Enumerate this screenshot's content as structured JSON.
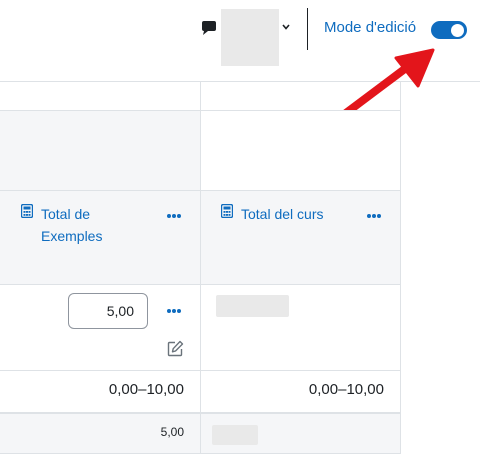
{
  "navbar": {
    "messages_icon": "chat-bubble-icon",
    "user_menu_icon": "chevron-down-icon",
    "edit_mode_label": "Mode d'edició",
    "edit_mode_on": true
  },
  "colors": {
    "accent": "#0f6cbf",
    "annotation": "#e3151b",
    "header_bg": "#f5f6f8",
    "border": "#dee2e6"
  },
  "columns": [
    {
      "title_line1": "Total de",
      "title_line2": "Exemples",
      "icon": "calculator-icon",
      "menu_icon": "more-horizontal-icon"
    },
    {
      "title_line1": "Total del curs",
      "icon": "calculator-icon",
      "menu_icon": "more-horizontal-icon"
    }
  ],
  "grade_row": {
    "value": "5,00",
    "edit_icon": "pencil-edit-icon"
  },
  "range_row": {
    "col1": "0,00–10,00",
    "col2": "0,00–10,00"
  },
  "average_row": {
    "col1": "5,00"
  }
}
